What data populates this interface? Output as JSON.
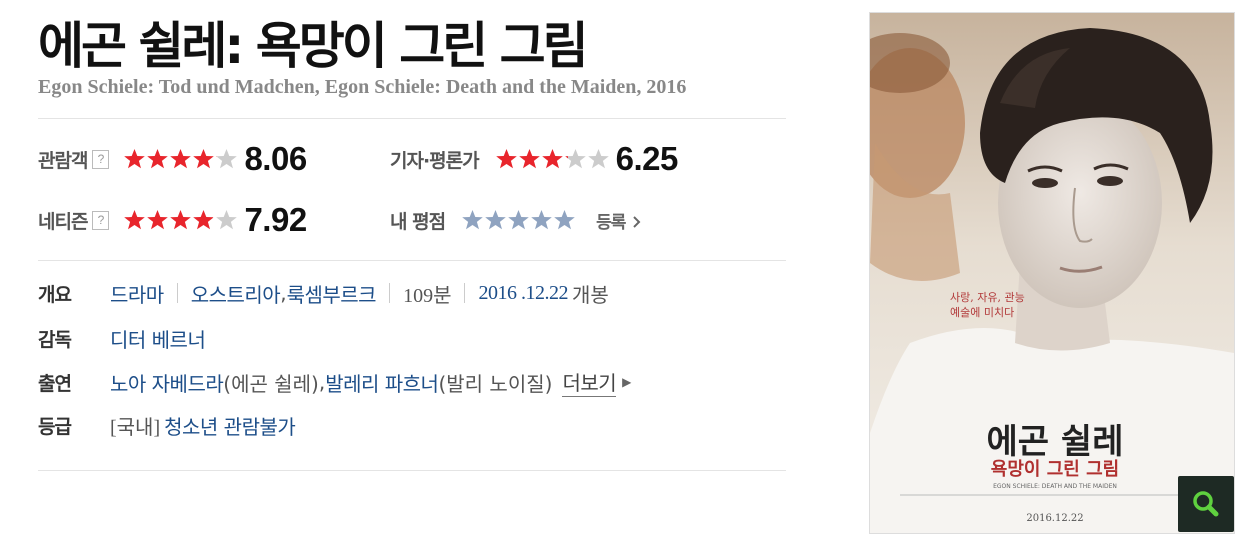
{
  "movie": {
    "title": "에곤 쉴레: 욕망이 그린 그림",
    "original_title": "Egon Schiele: Tod und Madchen, Egon Schiele: Death and the Maiden, 2016"
  },
  "ratings": {
    "audience": {
      "label": "관람객",
      "help": "?",
      "score": "8.06",
      "stars": 4.03
    },
    "critics": {
      "label": "기자·평론가",
      "score": "6.25",
      "stars": 3.13
    },
    "netizen": {
      "label": "네티즌",
      "help": "?",
      "score": "7.92",
      "stars": 3.96
    },
    "mine": {
      "label": "내 평점",
      "stars": 0,
      "register": "등록"
    }
  },
  "info": {
    "overview": {
      "label": "개요",
      "genre": "드라마",
      "countries": [
        "오스트리아",
        "룩셈부르크"
      ],
      "country_sep": ",",
      "runtime": "109분",
      "release_date": "2016 .12.22",
      "release_suffix": "개봉"
    },
    "director": {
      "label": "감독",
      "name": "디터 베르너"
    },
    "cast": {
      "label": "출연",
      "actors": [
        {
          "name": "노아 자베드라",
          "role": "(에곤 쉴레)"
        },
        {
          "name": "발레리 파흐너",
          "role": "(발리 노이질)"
        }
      ],
      "sep": ",",
      "more": "더보기"
    },
    "grade": {
      "label": "등급",
      "prefix": "[국내]",
      "value": "청소년 관람불가"
    }
  },
  "poster": {
    "tagline_line1": "사랑, 자유, 관능",
    "tagline_line2": "예술에 미치다",
    "title_line1": "에곤 쉴레",
    "title_line2": "욕망이 그린 그림",
    "english": "EGON SCHIELE: DEATH AND THE MAIDEN",
    "date": "2016.12.22"
  },
  "colors": {
    "star_red": "#e8252c",
    "star_empty": "#cccccc",
    "star_blue": "#8fa3c0",
    "link_blue": "#1d4e89",
    "zoom_bg": "#1e2a24",
    "zoom_icon": "#5fd13f"
  },
  "icons": {
    "help": "question-box-icon",
    "register_arrow": "chevron-right-icon",
    "more_arrow": "triangle-right-icon",
    "zoom": "magnifier-icon"
  }
}
